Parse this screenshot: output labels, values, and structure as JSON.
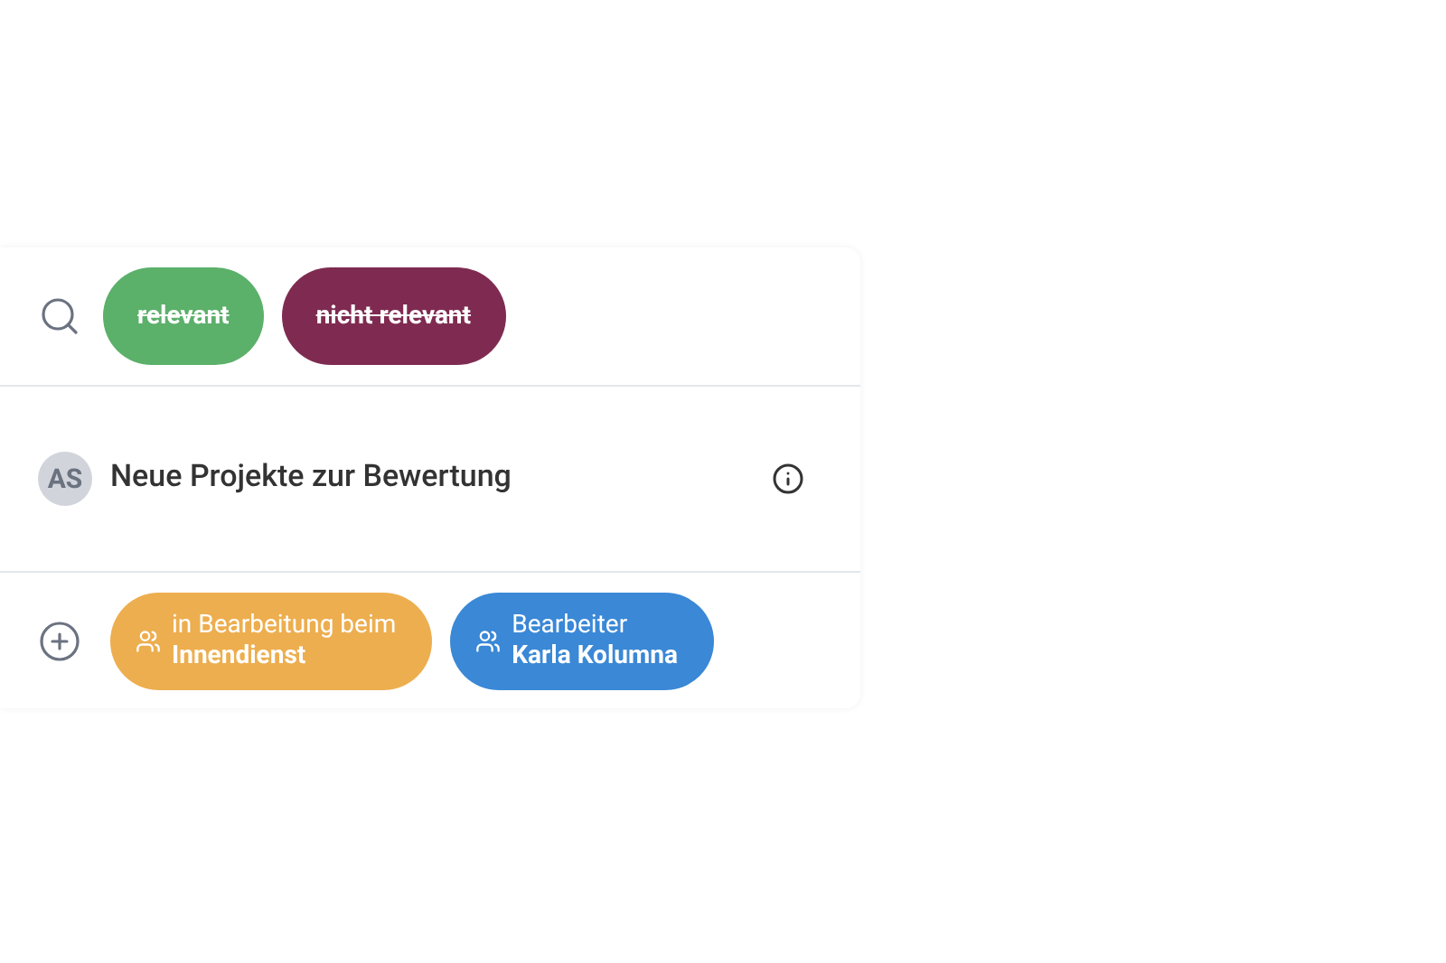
{
  "filters": [
    {
      "label": "relevant",
      "struck": true,
      "color": "#5bb06a"
    },
    {
      "label": "nicht relevant",
      "struck": true,
      "color": "#7f2b51"
    }
  ],
  "item": {
    "avatar": "AS",
    "title": "Neue Projekte zur Bewertung"
  },
  "tags": [
    {
      "line1": "in Bearbeitung beim",
      "line2": "Innendienst",
      "color": "#edae4f"
    },
    {
      "line1": "Bearbeiter",
      "line2": "Karla Kolumna",
      "color": "#3a88d6"
    }
  ]
}
